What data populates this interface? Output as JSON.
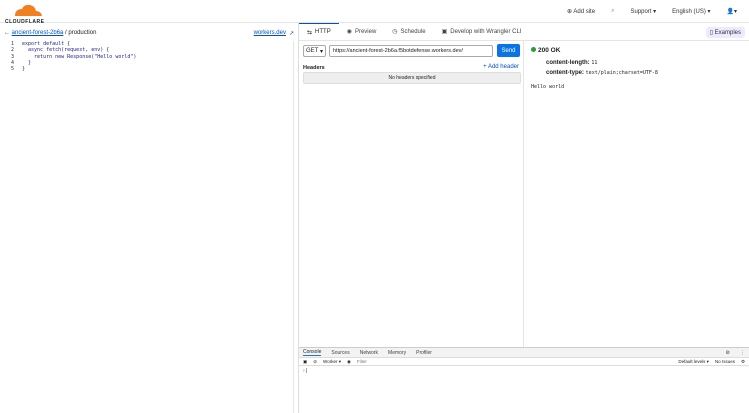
{
  "header": {
    "logo": "CLOUDFLARE",
    "add_site": "Add site",
    "support": "Support",
    "language": "English (US)"
  },
  "breadcrumb": {
    "worker": "ancient-forest-2b6a",
    "env": "production",
    "workers_dev": "workers.dev"
  },
  "code": [
    "export default {",
    "  async fetch(request, env) {",
    "    return new Response(\"Hello world\")",
    "  }",
    "}"
  ],
  "tabs": [
    "HTTP",
    "Preview",
    "Schedule",
    "Develop with Wrangler CLI"
  ],
  "examples": "Examples",
  "request": {
    "method": "GET",
    "url": "https://ancient-forest-2b6a.f5botdefense.workers.dev/",
    "send": "Send",
    "headers_label": "Headers",
    "add_header": "Add header",
    "no_headers": "No headers specified"
  },
  "response": {
    "status": "200 OK",
    "headers": [
      {
        "k": "content-length:",
        "v": "11"
      },
      {
        "k": "content-type:",
        "v": "text/plain;charset=UTF-8"
      }
    ],
    "body": "Hello world"
  },
  "devtools": {
    "tabs": [
      "Console",
      "Sources",
      "Network",
      "Memory",
      "Profiler"
    ],
    "context": "Worker",
    "filter": "Filter",
    "levels": "Default levels",
    "issues": "No Issues",
    "prompt": "›"
  }
}
